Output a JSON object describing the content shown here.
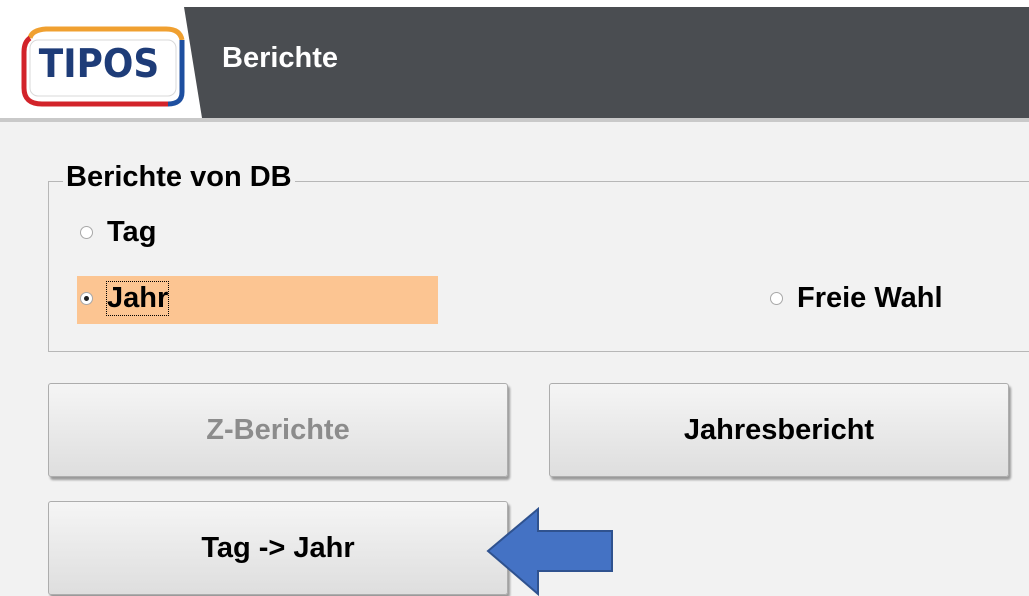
{
  "header": {
    "logo_text": "TIPOS",
    "title": "Berichte"
  },
  "group": {
    "legend": "Berichte von DB",
    "options": [
      {
        "label": "Tag",
        "checked": false
      },
      {
        "label": "Jahr",
        "checked": true,
        "highlight_color": "#fcc592"
      },
      {
        "label": "Freie Wahl",
        "checked": false
      }
    ]
  },
  "buttons": {
    "z_berichte": "Z-Berichte",
    "jahresbericht": "Jahresbericht",
    "tag_jahr": "Tag -> Jahr"
  },
  "annotation": {
    "arrow_color": "#4472c4",
    "arrow_direction": "left"
  },
  "colors": {
    "header_bg": "#4a4d51",
    "logo_blue": "#1e3c78",
    "logo_orange": "#f0a030",
    "logo_red": "#d2232a",
    "disabled_text": "#8c8c8c"
  }
}
